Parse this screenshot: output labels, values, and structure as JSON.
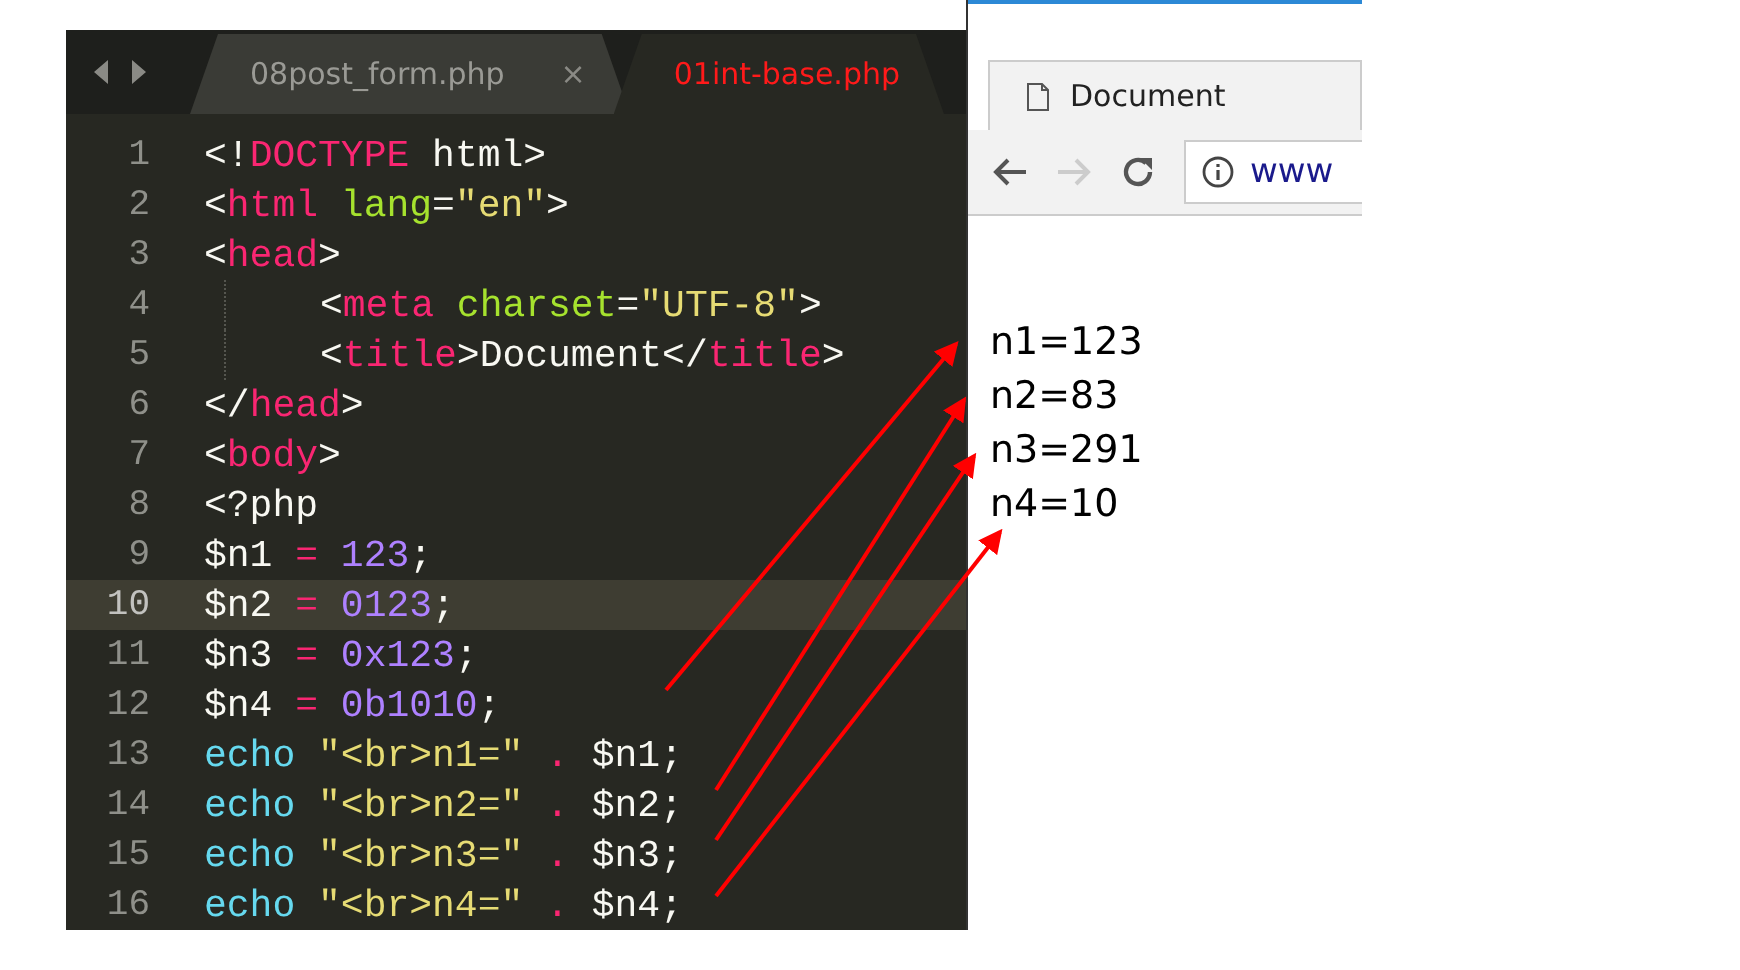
{
  "editor": {
    "tabs": [
      {
        "label": "08post_form.php",
        "selected": false,
        "close": "×"
      },
      {
        "label": "01int-base.php",
        "selected": true
      }
    ],
    "lines": [
      {
        "number": "1",
        "current": false,
        "indent": false,
        "tokens": [
          {
            "kind": "plain",
            "text": "<!"
          },
          {
            "kind": "tag",
            "text": "DOCTYPE"
          },
          {
            "kind": "plain",
            "text": " html>"
          }
        ]
      },
      {
        "number": "2",
        "current": false,
        "indent": false,
        "tokens": [
          {
            "kind": "plain",
            "text": "<"
          },
          {
            "kind": "tag",
            "text": "html"
          },
          {
            "kind": "attr",
            "text": " lang"
          },
          {
            "kind": "plain",
            "text": "="
          },
          {
            "kind": "string",
            "text": "\"en\""
          },
          {
            "kind": "plain",
            "text": ">"
          }
        ]
      },
      {
        "number": "3",
        "current": false,
        "indent": false,
        "tokens": [
          {
            "kind": "plain",
            "text": "<"
          },
          {
            "kind": "tag",
            "text": "head"
          },
          {
            "kind": "plain",
            "text": ">"
          }
        ]
      },
      {
        "number": "4",
        "current": false,
        "indent": true,
        "tokens": [
          {
            "kind": "plain",
            "text": "<"
          },
          {
            "kind": "tag",
            "text": "meta"
          },
          {
            "kind": "attr",
            "text": " charset"
          },
          {
            "kind": "plain",
            "text": "="
          },
          {
            "kind": "string",
            "text": "\"UTF-8\""
          },
          {
            "kind": "plain",
            "text": ">"
          }
        ]
      },
      {
        "number": "5",
        "current": false,
        "indent": true,
        "tokens": [
          {
            "kind": "plain",
            "text": "<"
          },
          {
            "kind": "tag",
            "text": "title"
          },
          {
            "kind": "plain",
            "text": ">Document</"
          },
          {
            "kind": "tag",
            "text": "title"
          },
          {
            "kind": "plain",
            "text": ">"
          }
        ]
      },
      {
        "number": "6",
        "current": false,
        "indent": false,
        "tokens": [
          {
            "kind": "plain",
            "text": "</"
          },
          {
            "kind": "tag",
            "text": "head"
          },
          {
            "kind": "plain",
            "text": ">"
          }
        ]
      },
      {
        "number": "7",
        "current": false,
        "indent": false,
        "tokens": [
          {
            "kind": "plain",
            "text": "<"
          },
          {
            "kind": "tag",
            "text": "body"
          },
          {
            "kind": "plain",
            "text": ">"
          }
        ]
      },
      {
        "number": "8",
        "current": false,
        "indent": false,
        "tokens": [
          {
            "kind": "plain",
            "text": "<?php"
          }
        ]
      },
      {
        "number": "9",
        "current": false,
        "indent": false,
        "tokens": [
          {
            "kind": "plain",
            "text": "$n1 "
          },
          {
            "kind": "tag",
            "text": "="
          },
          {
            "kind": "number",
            "text": " 123"
          },
          {
            "kind": "plain",
            "text": ";"
          }
        ]
      },
      {
        "number": "10",
        "current": true,
        "indent": false,
        "tokens": [
          {
            "kind": "plain",
            "text": "$n2 "
          },
          {
            "kind": "tag",
            "text": "="
          },
          {
            "kind": "number",
            "text": " 0123"
          },
          {
            "kind": "plain",
            "text": ";"
          }
        ]
      },
      {
        "number": "11",
        "current": false,
        "indent": false,
        "tokens": [
          {
            "kind": "plain",
            "text": "$n3 "
          },
          {
            "kind": "tag",
            "text": "="
          },
          {
            "kind": "number",
            "text": " 0x123"
          },
          {
            "kind": "plain",
            "text": ";"
          }
        ]
      },
      {
        "number": "12",
        "current": false,
        "indent": false,
        "tokens": [
          {
            "kind": "plain",
            "text": "$n4 "
          },
          {
            "kind": "tag",
            "text": "="
          },
          {
            "kind": "number",
            "text": " 0b1010"
          },
          {
            "kind": "plain",
            "text": ";"
          }
        ]
      },
      {
        "number": "13",
        "current": false,
        "indent": false,
        "tokens": [
          {
            "kind": "keyword",
            "text": "echo"
          },
          {
            "kind": "string",
            "text": " \"<br>n1=\""
          },
          {
            "kind": "tag",
            "text": " ."
          },
          {
            "kind": "plain",
            "text": " $n1;"
          }
        ]
      },
      {
        "number": "14",
        "current": false,
        "indent": false,
        "tokens": [
          {
            "kind": "keyword",
            "text": "echo"
          },
          {
            "kind": "string",
            "text": " \"<br>n2=\""
          },
          {
            "kind": "tag",
            "text": " ."
          },
          {
            "kind": "plain",
            "text": " $n2;"
          }
        ]
      },
      {
        "number": "15",
        "current": false,
        "indent": false,
        "tokens": [
          {
            "kind": "keyword",
            "text": "echo"
          },
          {
            "kind": "string",
            "text": " \"<br>n3=\""
          },
          {
            "kind": "tag",
            "text": " ."
          },
          {
            "kind": "plain",
            "text": " $n3;"
          }
        ]
      },
      {
        "number": "16",
        "current": false,
        "indent": false,
        "tokens": [
          {
            "kind": "keyword",
            "text": "echo"
          },
          {
            "kind": "string",
            "text": " \"<br>n4=\""
          },
          {
            "kind": "tag",
            "text": " ."
          },
          {
            "kind": "plain",
            "text": " $n4;"
          }
        ]
      }
    ]
  },
  "browser": {
    "tab_title": "Document",
    "address": "www",
    "output": [
      "n1=123",
      "n2=83",
      "n3=291",
      "n4=10"
    ]
  }
}
